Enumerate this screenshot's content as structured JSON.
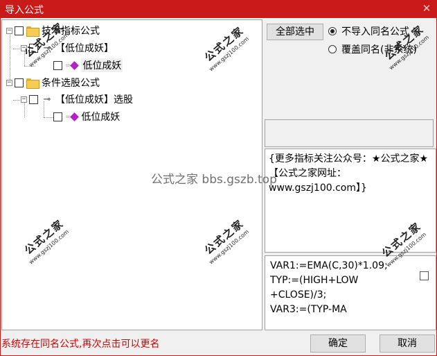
{
  "window": {
    "title": "导入公式",
    "close_glyph": "✕"
  },
  "tree": {
    "items": [
      {
        "label": "技术指标公式",
        "expander": "−"
      },
      {
        "label": "【低位成妖】",
        "expander": "−"
      },
      {
        "label": "低位成妖"
      },
      {
        "label": "条件选股公式",
        "expander": "−"
      },
      {
        "label": "【低位成妖】选股",
        "expander": "−"
      },
      {
        "label": "低位成妖"
      }
    ]
  },
  "options": {
    "select_all_label": "全部选中",
    "radio_skip_label": "不导入同名公式",
    "radio_overwrite_label": "覆盖同名(非系统)",
    "selected_radio": "skip"
  },
  "description": "{更多指标关注公众号：★公式之家★ 【公式之家网址：www.gszj100.com】}",
  "code": "VAR1:=EMA(C,30)*1.09;\nTYP:=(HIGH+LOW\n+CLOSE)/3;\nVAR3:=(TYP-MA",
  "status_text": "系统存在同名公式,再次点击可以更名",
  "buttons": {
    "ok_label": "确定",
    "cancel_label": "取消"
  },
  "watermark": {
    "stamp_text": "公式之家",
    "stamp_url": "www.gszj100.com",
    "center_text": "公式之家 bbs.gszb.top"
  },
  "colors": {
    "titlebar": "#c91a1a",
    "status_text": "#d40000",
    "gem_icon": "#b51fc6",
    "folder_icon": "#f5cd55"
  }
}
